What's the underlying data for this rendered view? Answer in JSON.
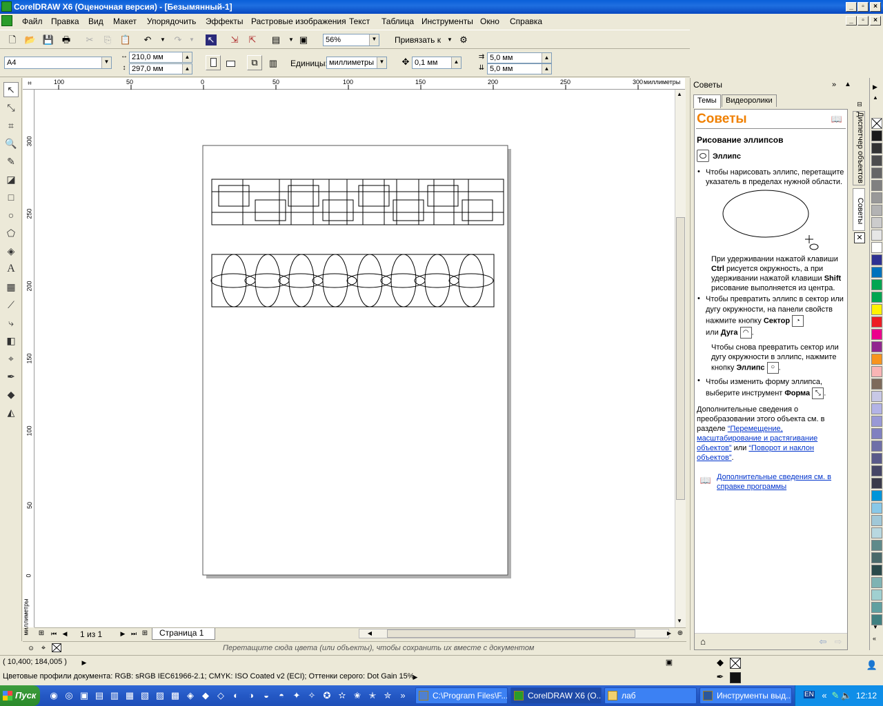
{
  "window": {
    "title": "CorelDRAW X6 (Оценочная версия) - [Безымянный-1]"
  },
  "menu": [
    "Файл",
    "Правка",
    "Вид",
    "Макет",
    "Упорядочить",
    "Эффекты",
    "Растровые изображения",
    "Текст",
    "Таблица",
    "Инструменты",
    "Окно",
    "Справка"
  ],
  "toolbar": {
    "zoom": "56%",
    "snap_label": "Привязать к"
  },
  "propbar": {
    "paper": "A4",
    "width": "210,0 мм",
    "height": "297,0 мм",
    "units_label": "Единицы:",
    "units": "миллиметры",
    "nudge": "0,1 мм",
    "dup_x": "5,0 мм",
    "dup_y": "5,0 мм"
  },
  "rulers": {
    "h": [
      "100",
      "50",
      "0",
      "50",
      "100",
      "150",
      "200",
      "250",
      "300"
    ],
    "h_unit": "миллиметры",
    "v": [
      "300",
      "250",
      "200",
      "150",
      "100",
      "50",
      "0"
    ],
    "v_unit": "миллиметры"
  },
  "pagenav": {
    "count": "1 из 1",
    "tab": "Страница 1"
  },
  "palette_hint": "Перетащите сюда цвета (или объекты), чтобы сохранить их вместе с документом",
  "status": {
    "coords": "( 10,400; 184,005 )",
    "profiles": "Цветовые профили документа: RGB: sRGB IEC61966-2.1; CMYK: ISO Coated v2 (ECI); Оттенки серого: Dot Gain 15%"
  },
  "docker": {
    "title": "Советы",
    "tabs": [
      "Темы",
      "Видеоролики"
    ],
    "heading": "Советы",
    "subheading": "Рисование эллипсов",
    "tool_name": "Эллипс",
    "bullet1": "Чтобы нарисовать эллипс, перетащите указатель в пределах нужной области.",
    "note1_a": "При удерживании нажатой клавиши ",
    "note1_ctrl": "Ctrl",
    "note1_b": " рисуется окружность, а при удерживании нажатой клавиши ",
    "note1_shift": "Shift",
    "note1_c": " рисование выполняется из центра.",
    "bullet2_a": "Чтобы превратить эллипс в сектор или дугу окружности, на панели свойств нажмите кнопку ",
    "bullet2_sector": "Сектор",
    "bullet2_or": "или ",
    "bullet2_arc": "Дуга",
    "note2_a": "Чтобы снова превратить сектор или дугу окружности в эллипс, нажмите кнопку ",
    "note2_ellipse": "Эллипс",
    "bullet3_a": "Чтобы изменить форму эллипса, выберите инструмент ",
    "bullet3_shape": "Форма",
    "more_a": "Дополнительные сведения о преобразовании этого объекта см. в разделе ",
    "more_link1": "“Перемещение, масштабирование и растягивание объектов”",
    "more_or": " или ",
    "more_link2": "“Поворот и наклон объектов”",
    "more_end": ".",
    "help_link": "Дополнительные сведения см. в справке программы"
  },
  "sidetabs": [
    "Диспетчер объектов",
    "Советы"
  ],
  "palette_colors": [
    "#ffffff",
    "#1a1a1a",
    "#333333",
    "#4d4d4d",
    "#666666",
    "#808080",
    "#999999",
    "#b3b3b3",
    "#cccccc",
    "#e6e6e6",
    "#ffffff",
    "#2e3192",
    "#0072bc",
    "#00a651",
    "#00a651",
    "#fff200",
    "#ed1c24",
    "#ec008c",
    "#92278f",
    "#f7941d",
    "#f9b5b5",
    "#7d6a5a",
    "#c8c8e6",
    "#b3b3e6",
    "#9999d6",
    "#8080c0",
    "#6f6fa8",
    "#5a5a8a",
    "#464666",
    "#3a3a4a",
    "#0095da",
    "#88c8e8",
    "#a0c8d8",
    "#b8d8e0",
    "#5f8a8a",
    "#4a6a6a",
    "#2a4a4a",
    "#7fb3b3",
    "#a0d0d0",
    "#60a0a0",
    "#408080"
  ],
  "taskbar": {
    "start": "Пуск",
    "items": [
      "C:\\Program Files\\F...",
      "CorelDRAW X6 (O...",
      "лаб",
      "Инструменты выд..."
    ],
    "lang": "EN",
    "clock": "12:12"
  }
}
